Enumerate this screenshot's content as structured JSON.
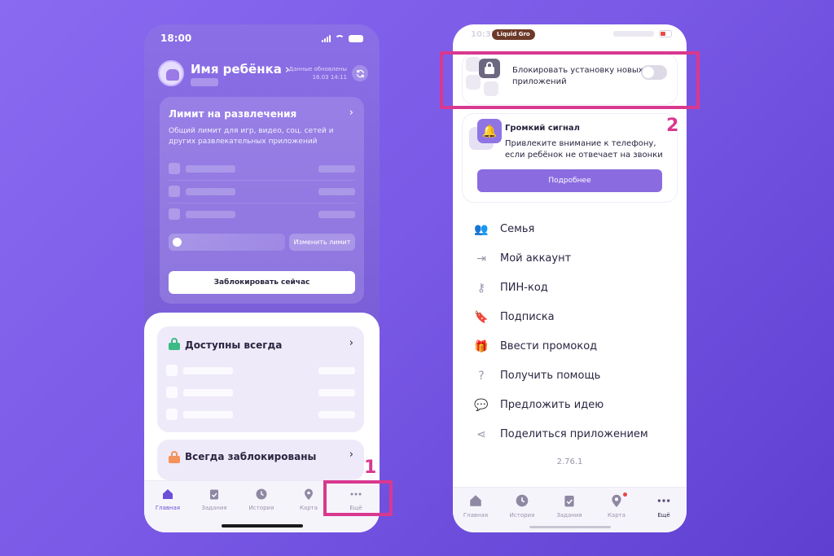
{
  "left_phone": {
    "status_time": "18:00",
    "child_name": "Имя ребёнка",
    "child_name_chevron": "›",
    "updated_label": "Данные обновлены",
    "updated_time": "16.03 14:11",
    "refresh_icon": "refresh-icon",
    "limit_card": {
      "title": "Лимит на развлечения",
      "chevron": "›",
      "description": "Общий лимит для игр, видео, соц. сетей и других развлекательных приложений",
      "change_limit_label": "Изменить лимит",
      "block_now_label": "Заблокировать сейчас"
    },
    "available_card": {
      "title": "Доступны всегда",
      "chevron": "›"
    },
    "blocked_card": {
      "title": "Всегда заблокированы",
      "chevron": "›"
    },
    "tabs": [
      {
        "label": "Главная",
        "icon": "home-icon",
        "active": true
      },
      {
        "label": "Задания",
        "icon": "clipboard-icon",
        "active": false
      },
      {
        "label": "История",
        "icon": "clock-icon",
        "active": false
      },
      {
        "label": "Карта",
        "icon": "map-pin-icon",
        "active": false
      },
      {
        "label": "Ещё",
        "icon": "more-dots-icon",
        "active": false
      }
    ],
    "callout_number": "1",
    "callout_color": "#d9388f"
  },
  "right_phone": {
    "status_time": "10:37",
    "live_activity_label": "Liquid Gro",
    "block_install": {
      "label": "Блокировать установку новых приложений",
      "toggle_on": false
    },
    "loud_signal": {
      "title": "Громкий сигнал",
      "description": "Привлеките внимание к телефону, если ребёнок не отвечает на звонки",
      "button_label": "Подробнее"
    },
    "menu": [
      {
        "label": "Семья",
        "icon": "people-icon",
        "glyph": "👥"
      },
      {
        "label": "Мой аккаунт",
        "icon": "login-icon",
        "glyph": "⇥"
      },
      {
        "label": "ПИН-код",
        "icon": "key-icon",
        "glyph": "⚷"
      },
      {
        "label": "Подписка",
        "icon": "bookmark-icon",
        "glyph": "🔖"
      },
      {
        "label": "Ввести промокод",
        "icon": "gift-icon",
        "glyph": "🎁"
      },
      {
        "label": "Получить помощь",
        "icon": "help-icon",
        "glyph": "?"
      },
      {
        "label": "Предложить идею",
        "icon": "chat-icon",
        "glyph": "💬"
      },
      {
        "label": "Поделиться приложением",
        "icon": "share-icon",
        "glyph": "⋖"
      }
    ],
    "version": "2.76.1",
    "tabs": [
      {
        "label": "Главная",
        "icon": "home-icon",
        "active": false
      },
      {
        "label": "История",
        "icon": "clock-icon",
        "active": false
      },
      {
        "label": "Задания",
        "icon": "clipboard-icon",
        "active": false
      },
      {
        "label": "Карта",
        "icon": "map-pin-icon",
        "active": false,
        "badge": true
      },
      {
        "label": "Ещё",
        "icon": "more-dots-icon",
        "active": true
      }
    ],
    "callout_number": "2",
    "callout_color": "#d9388f"
  },
  "colors": {
    "accent": "#8a6be0",
    "tab_active": "#6b4fd8",
    "highlight": "#d9388f",
    "green_lock": "#3dbb85",
    "orange_lock": "#f4925a"
  }
}
